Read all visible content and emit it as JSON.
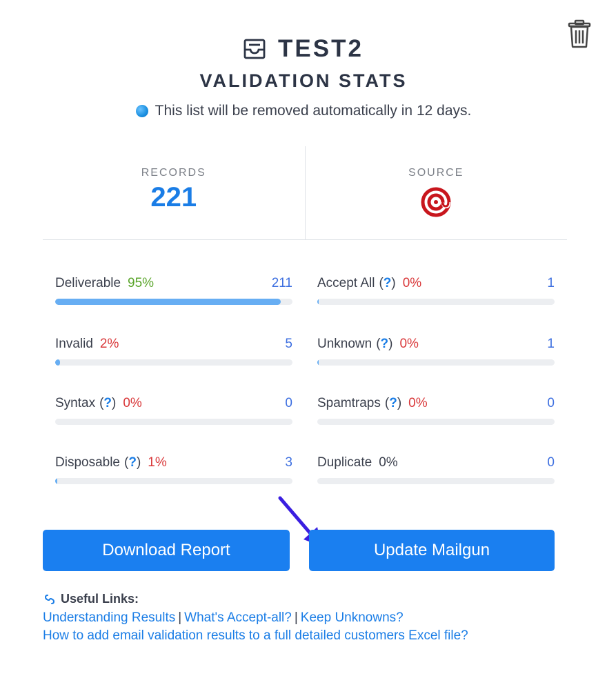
{
  "header": {
    "title": "TEST2",
    "subtitle": "VALIDATION STATS",
    "notice": "This list will be removed automatically in 12 days."
  },
  "stats": {
    "records_label": "RECORDS",
    "records_value": "221",
    "source_label": "SOURCE",
    "source_logo": "mailgun-logo"
  },
  "metrics": [
    {
      "label": "Deliverable",
      "help": false,
      "percent": "95%",
      "percent_color": "green",
      "count": "211",
      "fill_fraction": 0.95
    },
    {
      "label": "Accept All",
      "help": true,
      "percent": "0%",
      "percent_color": "red",
      "count": "1",
      "fill_fraction": 0.005
    },
    {
      "label": "Invalid",
      "help": false,
      "percent": "2%",
      "percent_color": "red",
      "count": "5",
      "fill_fraction": 0.02
    },
    {
      "label": "Unknown",
      "help": true,
      "percent": "0%",
      "percent_color": "red",
      "count": "1",
      "fill_fraction": 0.005
    },
    {
      "label": "Syntax",
      "help": true,
      "percent": "0%",
      "percent_color": "red",
      "count": "0",
      "fill_fraction": 0
    },
    {
      "label": "Spamtraps",
      "help": true,
      "percent": "0%",
      "percent_color": "red",
      "count": "0",
      "fill_fraction": 0
    },
    {
      "label": "Disposable",
      "help": true,
      "percent": "1%",
      "percent_color": "red",
      "count": "3",
      "fill_fraction": 0.01
    },
    {
      "label": "Duplicate",
      "help": false,
      "percent": "0%",
      "percent_color": "dark",
      "count": "0",
      "fill_fraction": 0
    }
  ],
  "help_text": "?",
  "buttons": {
    "download": "Download Report",
    "update": "Update Mailgun"
  },
  "links": {
    "title": "Useful Links:",
    "items": [
      "Understanding Results",
      "What's Accept-all?",
      "Keep Unknowns?",
      "How to add email validation results to a full detailed customers Excel file?"
    ],
    "separator": "|"
  },
  "colors": {
    "accent": "#1a7ff0",
    "bar_fill": "#67aef3",
    "green": "#5aa52b",
    "red": "#d9383a",
    "arrow": "#3a1ee0"
  }
}
